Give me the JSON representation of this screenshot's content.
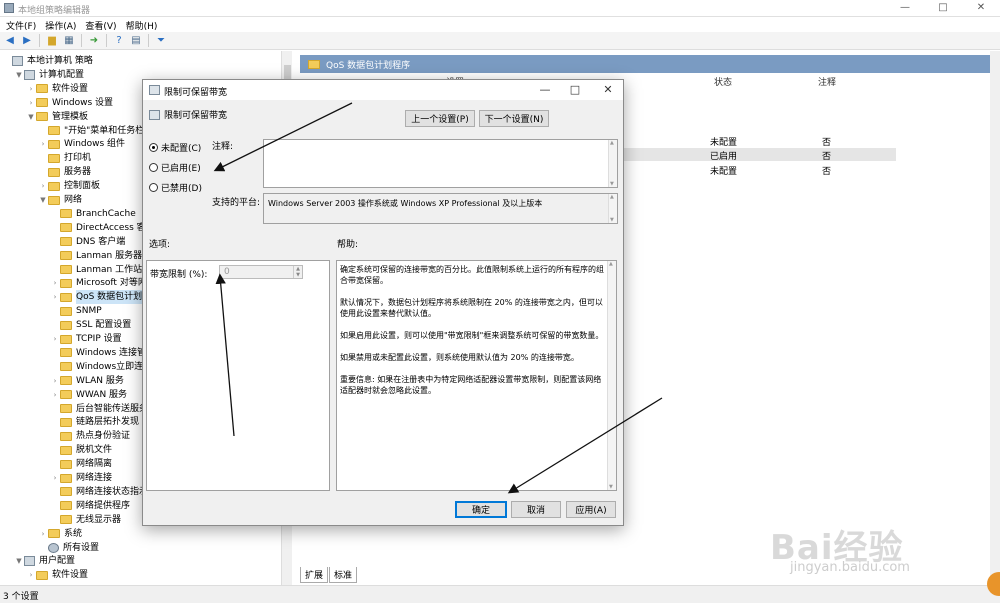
{
  "window": {
    "title": "本地组策略编辑器",
    "minimize": "—",
    "maximize": "□",
    "close": "✕"
  },
  "menu": [
    "文件(F)",
    "操作(A)",
    "查看(V)",
    "帮助(H)"
  ],
  "tree": {
    "items": [
      {
        "label": "本地计算机 策略",
        "depth": 0,
        "arrow": "",
        "icon": "node"
      },
      {
        "label": "计算机配置",
        "depth": 1,
        "arrow": "▼",
        "icon": "node"
      },
      {
        "label": "软件设置",
        "depth": 2,
        "arrow": "›",
        "icon": "folder"
      },
      {
        "label": "Windows 设置",
        "depth": 2,
        "arrow": "›",
        "icon": "folder"
      },
      {
        "label": "管理模板",
        "depth": 2,
        "arrow": "▼",
        "icon": "folder"
      },
      {
        "label": "\"开始\"菜单和任务栏",
        "depth": 3,
        "arrow": "",
        "icon": "folder"
      },
      {
        "label": "Windows 组件",
        "depth": 3,
        "arrow": "›",
        "icon": "folder"
      },
      {
        "label": "打印机",
        "depth": 3,
        "arrow": "",
        "icon": "folder"
      },
      {
        "label": "服务器",
        "depth": 3,
        "arrow": "",
        "icon": "folder"
      },
      {
        "label": "控制面板",
        "depth": 3,
        "arrow": "›",
        "icon": "folder"
      },
      {
        "label": "网络",
        "depth": 3,
        "arrow": "▼",
        "icon": "folder"
      },
      {
        "label": "BranchCache",
        "depth": 4,
        "arrow": "",
        "icon": "folder"
      },
      {
        "label": "DirectAccess 客户",
        "depth": 4,
        "arrow": "",
        "icon": "folder"
      },
      {
        "label": "DNS 客户端",
        "depth": 4,
        "arrow": "",
        "icon": "folder"
      },
      {
        "label": "Lanman 服务器",
        "depth": 4,
        "arrow": "",
        "icon": "folder"
      },
      {
        "label": "Lanman 工作站",
        "depth": 4,
        "arrow": "",
        "icon": "folder"
      },
      {
        "label": "Microsoft 对等网",
        "depth": 4,
        "arrow": "›",
        "icon": "folder"
      },
      {
        "label": "QoS 数据包计划程",
        "depth": 4,
        "arrow": "›",
        "icon": "folder",
        "selected": true
      },
      {
        "label": "SNMP",
        "depth": 4,
        "arrow": "",
        "icon": "folder"
      },
      {
        "label": "SSL 配置设置",
        "depth": 4,
        "arrow": "",
        "icon": "folder"
      },
      {
        "label": "TCPIP 设置",
        "depth": 4,
        "arrow": "›",
        "icon": "folder"
      },
      {
        "label": "Windows 连接管理",
        "depth": 4,
        "arrow": "",
        "icon": "folder"
      },
      {
        "label": "Windows立即连接",
        "depth": 4,
        "arrow": "",
        "icon": "folder"
      },
      {
        "label": "WLAN 服务",
        "depth": 4,
        "arrow": "›",
        "icon": "folder"
      },
      {
        "label": "WWAN 服务",
        "depth": 4,
        "arrow": "›",
        "icon": "folder"
      },
      {
        "label": "后台智能传送服务(",
        "depth": 4,
        "arrow": "",
        "icon": "folder"
      },
      {
        "label": "链路层拓扑发现",
        "depth": 4,
        "arrow": "",
        "icon": "folder"
      },
      {
        "label": "热点身份验证",
        "depth": 4,
        "arrow": "",
        "icon": "folder"
      },
      {
        "label": "脱机文件",
        "depth": 4,
        "arrow": "",
        "icon": "folder"
      },
      {
        "label": "网络隔离",
        "depth": 4,
        "arrow": "",
        "icon": "folder"
      },
      {
        "label": "网络连接",
        "depth": 4,
        "arrow": "›",
        "icon": "folder"
      },
      {
        "label": "网络连接状态指示器",
        "depth": 4,
        "arrow": "",
        "icon": "folder"
      },
      {
        "label": "网络提供程序",
        "depth": 4,
        "arrow": "",
        "icon": "folder"
      },
      {
        "label": "无线显示器",
        "depth": 4,
        "arrow": "",
        "icon": "folder"
      },
      {
        "label": "系统",
        "depth": 3,
        "arrow": "›",
        "icon": "folder"
      },
      {
        "label": "所有设置",
        "depth": 3,
        "arrow": "",
        "icon": "gear"
      },
      {
        "label": "用户配置",
        "depth": 1,
        "arrow": "▼",
        "icon": "node"
      },
      {
        "label": "软件设置",
        "depth": 2,
        "arrow": "›",
        "icon": "folder"
      }
    ]
  },
  "right": {
    "header": "QoS 数据包计划程序",
    "col_setting": "设置",
    "col_state": "状态",
    "col_comment": "注释",
    "rows": [
      {
        "state": "未配置",
        "comment": "否"
      },
      {
        "state": "已启用",
        "comment": "否"
      },
      {
        "state": "未配置",
        "comment": "否"
      }
    ],
    "tabs": [
      "扩展",
      "标准"
    ]
  },
  "status": "3 个设置",
  "dialog": {
    "title": "限制可保留带宽",
    "heading": "限制可保留带宽",
    "prev_button": "上一个设置(P)",
    "next_button": "下一个设置(N)",
    "radio_not_configured": "未配置(C)",
    "radio_enabled": "已启用(E)",
    "radio_disabled": "已禁用(D)",
    "comment_label": "注释:",
    "platform_label": "支持的平台:",
    "platform_value": "Windows Server 2003 操作系统或 Windows XP Professional 及以上版本",
    "options_label": "选项:",
    "help_label": "帮助:",
    "bandwidth_label": "带宽限制 (%):",
    "bandwidth_value": "0",
    "help_p1": "确定系统可保留的连接带宽的百分比。此值限制系统上运行的所有程序的组合带宽保留。",
    "help_p2": "默认情况下，数据包计划程序将系统限制在 20% 的连接带宽之内，但可以使用此设置来替代默认值。",
    "help_p3": "如果启用此设置，则可以使用\"带宽限制\"框来调整系统可保留的带宽数量。",
    "help_p4": "如果禁用或未配置此设置，则系统使用默认值为 20% 的连接带宽。",
    "help_p5": "重要信息: 如果在注册表中为特定网络适配器设置带宽限制，则配置该网络适配器时就会忽略此设置。",
    "ok_button": "确定",
    "cancel_button": "取消",
    "apply_button": "应用(A)"
  },
  "watermark": {
    "logo": "Bai经验",
    "url": "jingyan.baidu.com"
  }
}
